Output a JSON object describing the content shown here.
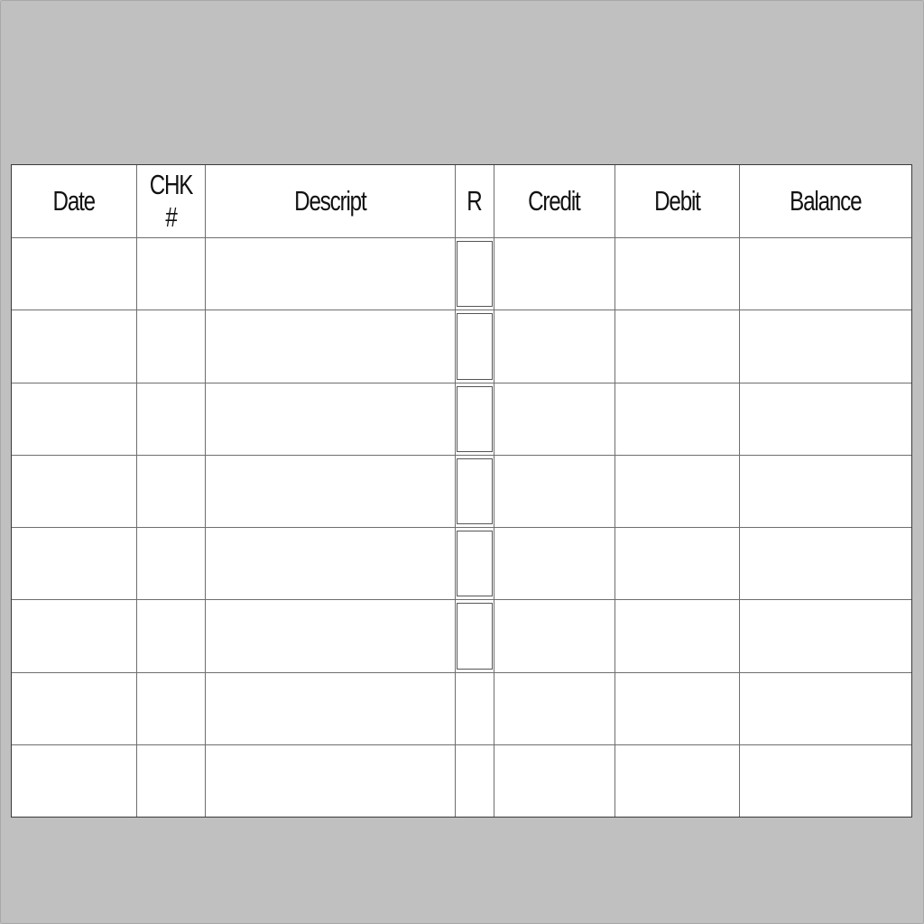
{
  "register": {
    "columns": [
      "Date",
      "CHK #",
      "Descript",
      "R",
      "Credit",
      "Debit",
      "Balance"
    ],
    "rows": [
      [
        "",
        "",
        "",
        "",
        "",
        "",
        ""
      ],
      [
        "",
        "",
        "",
        "",
        "",
        "",
        ""
      ],
      [
        "",
        "",
        "",
        "",
        "",
        "",
        ""
      ],
      [
        "",
        "",
        "",
        "",
        "",
        "",
        ""
      ],
      [
        "",
        "",
        "",
        "",
        "",
        "",
        ""
      ],
      [
        "",
        "",
        "",
        "",
        "",
        "",
        ""
      ],
      [
        "",
        "",
        "",
        "",
        "",
        "",
        ""
      ],
      [
        "",
        "",
        "",
        "",
        "",
        "",
        ""
      ]
    ]
  }
}
